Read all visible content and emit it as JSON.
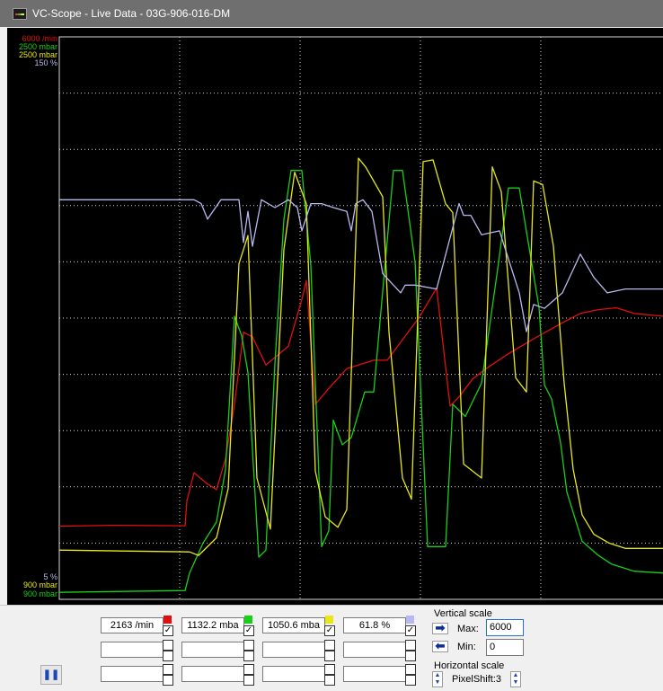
{
  "window": {
    "title": "VC-Scope  -  Live Data  -  03G-906-016-DM"
  },
  "scale_labels": {
    "top": [
      {
        "text": "6000 /min",
        "color": "#e01010"
      },
      {
        "text": "2500 mbar",
        "color": "#18d018"
      },
      {
        "text": "2500 mbar",
        "color": "#e8e818"
      },
      {
        "text": "150 %",
        "color": "#b8b8f0"
      }
    ],
    "bottom": [
      {
        "text": "5 %",
        "color": "#b8b8f0"
      },
      {
        "text": "900 mbar",
        "color": "#e8e818"
      },
      {
        "text": "900 mbar",
        "color": "#18d018"
      }
    ]
  },
  "chart_data": {
    "type": "line",
    "xlabel": "",
    "ylabel": "",
    "grid": true,
    "x_range": [
      0,
      672
    ],
    "series": [
      {
        "channel": 1,
        "color": "#e01010",
        "unit": "/min",
        "ylim": [
          0,
          6000
        ],
        "x": [
          0,
          60,
          140,
          142,
          150,
          165,
          175,
          185,
          195,
          205,
          215,
          230,
          255,
          270,
          275,
          285,
          300,
          320,
          350,
          365,
          400,
          420,
          435,
          445,
          460,
          475,
          500,
          530,
          560,
          580,
          600,
          620,
          640,
          672
        ],
        "values": [
          780,
          790,
          785,
          1050,
          1350,
          1230,
          1170,
          1500,
          2080,
          2850,
          2800,
          2500,
          2700,
          3200,
          3400,
          2080,
          2250,
          2460,
          2550,
          2550,
          3000,
          3320,
          2060,
          2160,
          2350,
          2460,
          2620,
          2790,
          2950,
          3050,
          3090,
          3110,
          3050,
          3020
        ]
      },
      {
        "channel": 2,
        "color": "#18d018",
        "unit": "mbar",
        "ylim": [
          900,
          2500
        ],
        "x": [
          0,
          140,
          145,
          160,
          175,
          185,
          195,
          203,
          210,
          222,
          230,
          240,
          250,
          258,
          270,
          280,
          292,
          300,
          305,
          315,
          325,
          340,
          350,
          372,
          382,
          396,
          410,
          430,
          438,
          452,
          470,
          488,
          500,
          512,
          534,
          540,
          548,
          558,
          565,
          582,
          600,
          615,
          640,
          672
        ],
        "values": [
          920,
          925,
          975,
          1060,
          1120,
          1270,
          1705,
          1650,
          1545,
          1020,
          1040,
          1570,
          1980,
          2120,
          2120,
          1850,
          1050,
          1095,
          1410,
          1340,
          1360,
          1490,
          1490,
          2120,
          2120,
          1860,
          1050,
          1050,
          1455,
          1420,
          1515,
          1840,
          2070,
          2070,
          1730,
          1510,
          1470,
          1345,
          1205,
          1065,
          1025,
          1000,
          980,
          975
        ]
      },
      {
        "channel": 3,
        "color": "#e8e818",
        "unit": "mbar",
        "ylim": [
          900,
          2500
        ],
        "x": [
          0,
          145,
          155,
          175,
          188,
          200,
          210,
          220,
          235,
          250,
          262,
          275,
          285,
          296,
          310,
          320,
          333,
          341,
          360,
          367,
          382,
          392,
          405,
          416,
          430,
          438,
          450,
          470,
          482,
          492,
          508,
          520,
          528,
          538,
          550,
          562,
          572,
          582,
          595,
          612,
          630,
          672
        ],
        "values": [
          1040,
          1035,
          1025,
          1075,
          1215,
          1855,
          1935,
          1245,
          1100,
          1895,
          2115,
          2025,
          1265,
          1135,
          1105,
          1155,
          2155,
          2130,
          2045,
          1660,
          1245,
          1185,
          2145,
          2150,
          2025,
          2000,
          1285,
          1245,
          2130,
          2060,
          1530,
          1490,
          2090,
          2080,
          1905,
          1515,
          1270,
          1140,
          1085,
          1060,
          1045,
          1045
        ]
      },
      {
        "channel": 4,
        "color": "#b8b8f0",
        "unit": "%",
        "ylim": [
          5,
          150
        ],
        "x": [
          0,
          150,
          158,
          165,
          180,
          200,
          205,
          210,
          215,
          225,
          240,
          255,
          265,
          270,
          280,
          292,
          305,
          320,
          325,
          330,
          338,
          348,
          360,
          380,
          385,
          396,
          420,
          445,
          450,
          458,
          470,
          490,
          512,
          520,
          528,
          540,
          560,
          580,
          595,
          610,
          630,
          672
        ],
        "values": [
          108,
          108,
          107,
          103,
          108,
          108,
          97,
          105,
          96,
          108,
          106,
          108,
          106,
          100,
          107,
          107,
          106,
          105,
          100,
          107,
          108,
          105,
          89,
          84,
          86,
          86,
          85,
          107,
          104,
          104,
          99,
          100,
          84,
          74,
          81,
          80,
          84,
          94,
          88,
          84,
          85,
          85
        ]
      }
    ]
  },
  "channels": [
    {
      "value": "2163 /min",
      "color": "#e01010",
      "checked": true
    },
    {
      "value": "1132.2 mba",
      "color": "#18d018",
      "checked": true
    },
    {
      "value": "1050.6 mba",
      "color": "#e8e818",
      "checked": true
    },
    {
      "value": "61.8 %",
      "color": "#b8b8f0",
      "checked": true
    }
  ],
  "empty_channels_count": 8,
  "vertical_scale": {
    "label": "Vertical scale",
    "max_label": "Max:",
    "max_value": "6000",
    "min_label": "Min:",
    "min_value": "0"
  },
  "horizontal_scale": {
    "label": "Horizontal scale",
    "value": "PixelShift:3"
  },
  "controls": {
    "pause_icon": "pause-icon",
    "left_arrow": "arrow-left-icon",
    "right_arrow": "arrow-right-icon",
    "spin": "spin-updown-icon"
  }
}
